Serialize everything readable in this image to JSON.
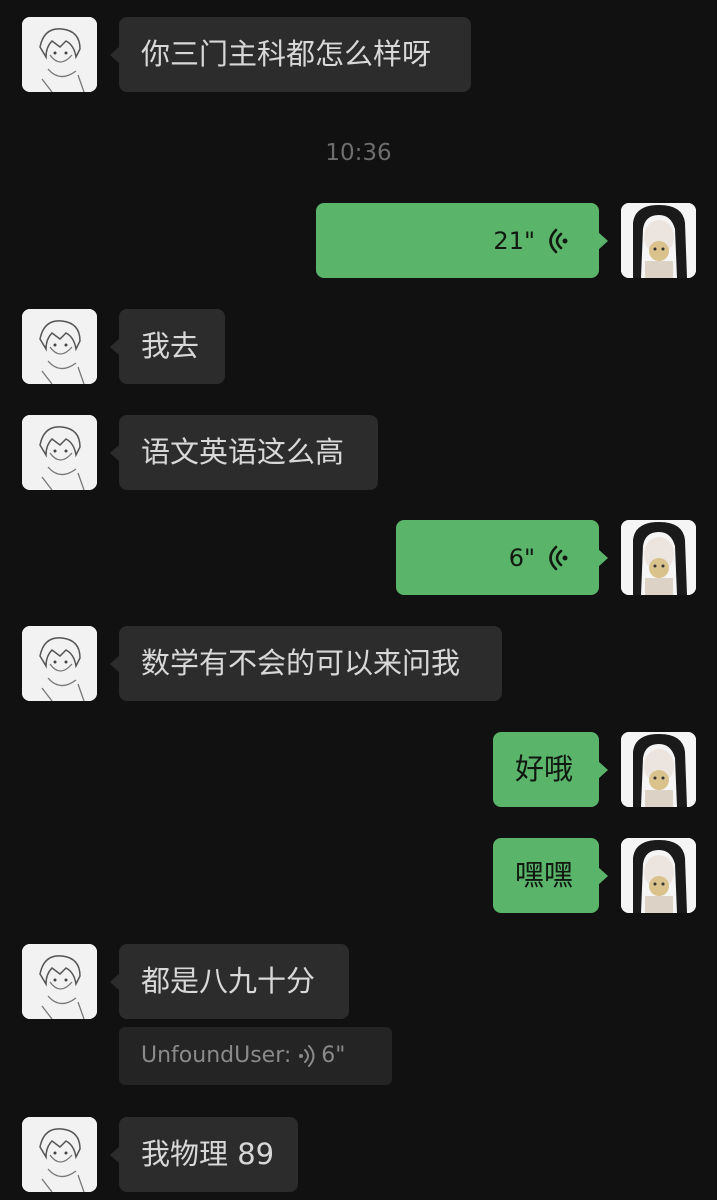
{
  "timestamp": "10:36",
  "messages": [
    {
      "side": "in",
      "type": "text",
      "text": "你三门主科都怎么样呀"
    },
    {
      "side": "out",
      "type": "voice",
      "duration": "21\""
    },
    {
      "side": "in",
      "type": "text",
      "text": "我去"
    },
    {
      "side": "in",
      "type": "text",
      "text": "语文英语这么高"
    },
    {
      "side": "out",
      "type": "voice",
      "duration": "6\""
    },
    {
      "side": "in",
      "type": "text",
      "text": "数学有不会的可以来问我"
    },
    {
      "side": "out",
      "type": "text",
      "text": "好哦"
    },
    {
      "side": "out",
      "type": "text",
      "text": "嘿嘿"
    },
    {
      "side": "in",
      "type": "text",
      "text": "都是八九十分"
    },
    {
      "side": "in",
      "type": "text",
      "text": "我物理 89"
    }
  ],
  "quote": {
    "sender": "UnfoundUser",
    "separator": ":",
    "duration": "6\""
  },
  "icons": {
    "voice": "voice-wave-icon",
    "avatar_in": "sketch-boy-avatar",
    "avatar_out": "girl-photo-avatar"
  },
  "colors": {
    "background": "#111111",
    "incoming_bubble": "#2c2c2c",
    "outgoing_bubble": "#5ab56a",
    "timestamp": "#6d6d6d"
  }
}
